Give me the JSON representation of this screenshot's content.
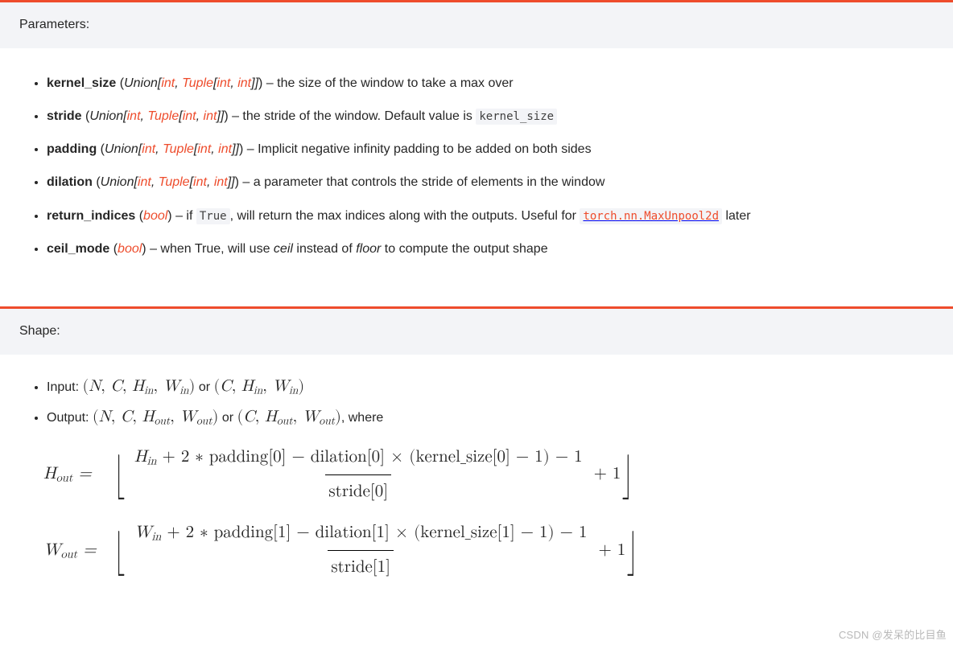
{
  "sections": {
    "parameters_title": "Parameters:",
    "shape_title": "Shape:"
  },
  "params": [
    {
      "name": "kernel_size",
      "type_prefix": "Union",
      "type_inner_a": "int",
      "type_inner_b_outer": "Tuple",
      "type_inner_b_a": "int",
      "type_inner_b_b": "int",
      "has_tuple": true,
      "desc": " – the size of the window to take a max over"
    },
    {
      "name": "stride",
      "type_prefix": "Union",
      "type_inner_a": "int",
      "type_inner_b_outer": "Tuple",
      "type_inner_b_a": "int",
      "type_inner_b_b": "int",
      "has_tuple": true,
      "desc": " – the stride of the window. Default value is ",
      "code": "kernel_size"
    },
    {
      "name": "padding",
      "type_prefix": "Union",
      "type_inner_a": "int",
      "type_inner_b_outer": "Tuple",
      "type_inner_b_a": "int",
      "type_inner_b_b": "int",
      "has_tuple": true,
      "desc": " – Implicit negative infinity padding to be added on both sides"
    },
    {
      "name": "dilation",
      "type_prefix": "Union",
      "type_inner_a": "int",
      "type_inner_b_outer": "Tuple",
      "type_inner_b_a": "int",
      "type_inner_b_b": "int",
      "has_tuple": true,
      "desc": " – a parameter that controls the stride of elements in the window"
    },
    {
      "name": "return_indices",
      "type_single": "bool",
      "desc": " – if ",
      "code": "True",
      "desc2": ", will return the max indices along with the outputs. Useful for ",
      "linkcode": "torch.nn.MaxUnpool2d",
      "desc3": " later"
    },
    {
      "name": "ceil_mode",
      "type_single": "bool",
      "desc": " – when True, will use ",
      "ital1": "ceil",
      "desc2": " instead of ",
      "ital2": "floor",
      "desc3": " to compute the output shape"
    }
  ],
  "shape": {
    "input_label": "Input: ",
    "output_label": "Output: ",
    "or": " or ",
    "where": ", where",
    "vars": {
      "N": "N",
      "C": "C",
      "H": "H",
      "W": "W",
      "in": "in",
      "out": "out"
    },
    "formula": {
      "H_lhs": "H",
      "W_lhs": "W",
      "eq": " = ",
      "plus1": " + 1",
      "num_H": "H",
      "num_W": "W",
      "plus2pad": " + 2 ∗ padding",
      "minus_dil": " − dilation",
      "times": " × (kernel_size",
      "minus1p": " − 1) − 1",
      "idx0": "[0]",
      "idx1": "[1]",
      "stride": "stride"
    }
  },
  "watermark": "CSDN @发呆的比目鱼"
}
